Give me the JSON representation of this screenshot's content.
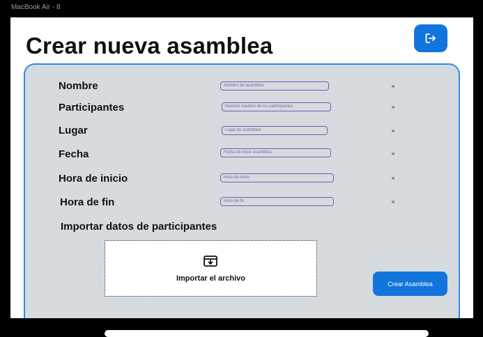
{
  "frame": {
    "label": "MacBook Air - 8"
  },
  "header": {
    "title": "Crear nueva asamblea",
    "logout_icon": "logout-icon"
  },
  "form": {
    "fields": [
      {
        "label": "Nombre",
        "placeholder": "Nombre de asamblea"
      },
      {
        "label": "Participantes",
        "placeholder": "Numero maximo de los participantes"
      },
      {
        "label": "Lugar",
        "placeholder": "Lugar de asamblea"
      },
      {
        "label": "Fecha",
        "placeholder": "Fecha de inicio asamblea"
      },
      {
        "label": "Hora de inicio",
        "placeholder": "Hora de inicio"
      },
      {
        "label": "Hora de fin",
        "placeholder": "Hora de fin"
      }
    ],
    "clear_symbol": "×"
  },
  "import": {
    "heading": "Importar datos de participantes",
    "button_label": "Importar el archivo",
    "icon": "import-download-icon"
  },
  "actions": {
    "create_label": "Crear Asamblea"
  },
  "colors": {
    "accent": "#1275dd",
    "panel_bg": "#d6dbe0",
    "panel_border": "#2d8ee8",
    "input_border": "#6b5fb8"
  }
}
